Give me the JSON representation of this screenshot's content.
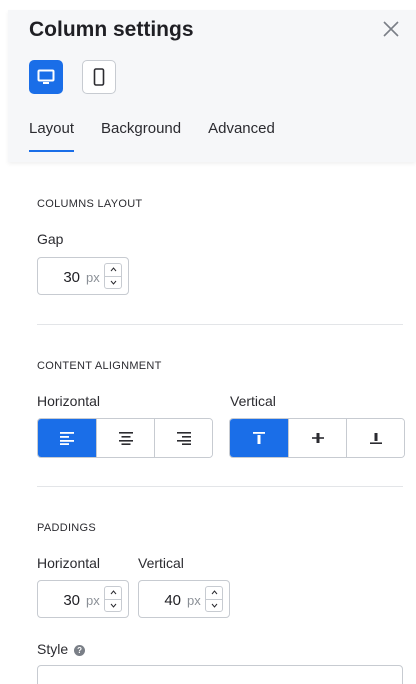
{
  "panel": {
    "title": "Column settings",
    "accent": "#1a6ee8"
  },
  "devices": [
    {
      "name": "desktop",
      "icon": "monitor-icon",
      "active": true
    },
    {
      "name": "mobile",
      "icon": "phone-icon",
      "active": false
    }
  ],
  "tabs": [
    {
      "label": "Layout",
      "active": true
    },
    {
      "label": "Background",
      "active": false
    },
    {
      "label": "Advanced",
      "active": false
    }
  ],
  "columns_layout": {
    "section_title": "COLUMNS LAYOUT",
    "gap_label": "Gap",
    "gap_value": "30",
    "gap_unit": "px"
  },
  "content_alignment": {
    "section_title": "CONTENT ALIGNMENT",
    "horizontal_label": "Horizontal",
    "vertical_label": "Vertical",
    "horizontal_options": [
      {
        "icon": "align-left-icon",
        "active": true
      },
      {
        "icon": "align-center-icon",
        "active": false
      },
      {
        "icon": "align-right-icon",
        "active": false
      }
    ],
    "vertical_options": [
      {
        "icon": "align-top-icon",
        "active": true
      },
      {
        "icon": "align-middle-icon",
        "active": false
      },
      {
        "icon": "align-bottom-icon",
        "active": false
      }
    ]
  },
  "paddings": {
    "section_title": "PADDINGS",
    "horizontal_label": "Horizontal",
    "horizontal_value": "30",
    "horizontal_unit": "px",
    "vertical_label": "Vertical",
    "vertical_value": "40",
    "vertical_unit": "px"
  },
  "style": {
    "label": "Style",
    "help_icon": "question-icon",
    "help_glyph": "?",
    "selected": ""
  }
}
